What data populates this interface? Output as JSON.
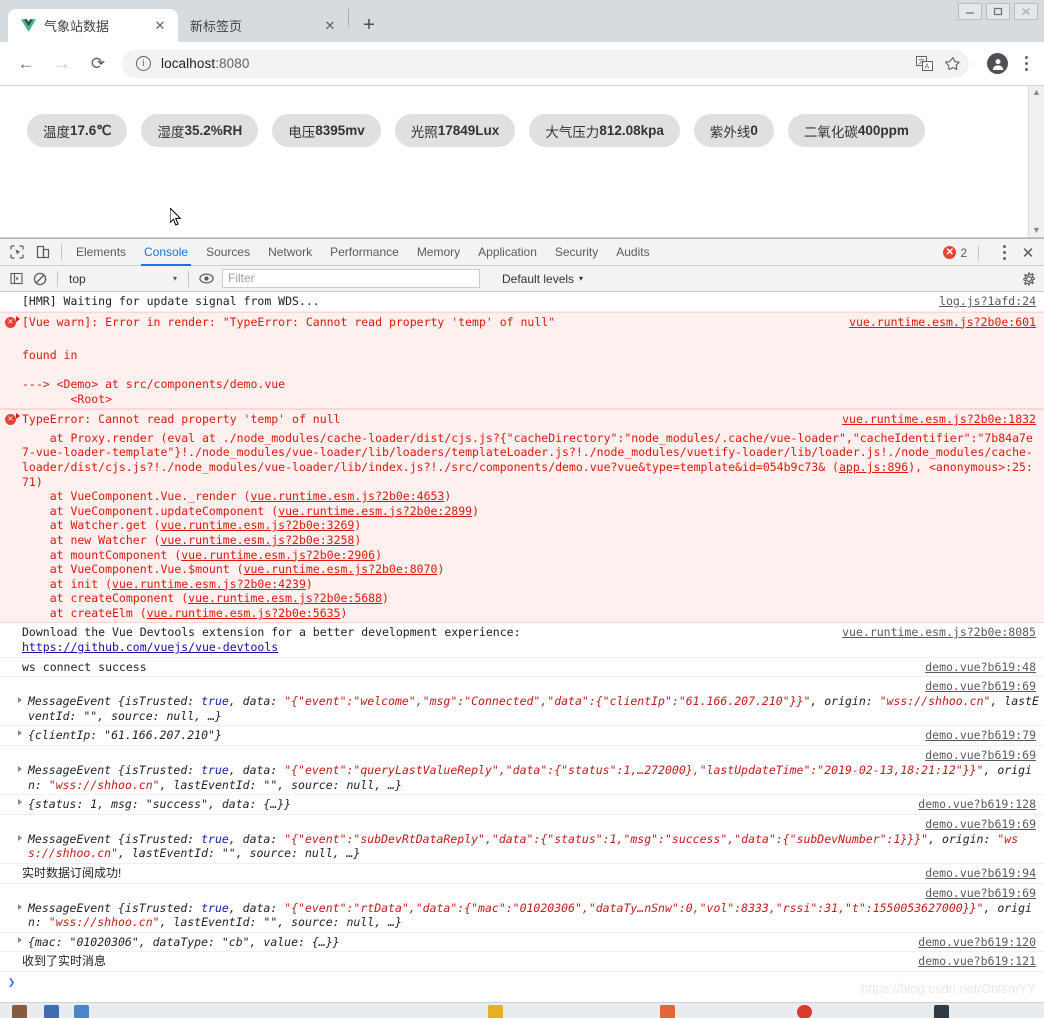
{
  "window": {
    "controls": {
      "minimize": "—",
      "maximize": "❐",
      "close": "✕"
    }
  },
  "tabs": [
    {
      "title": "气象站数据",
      "favicon": "vue-logo-icon",
      "close": "✕",
      "active": true
    },
    {
      "title": "新标签页",
      "favicon": "",
      "close": "✕",
      "active": false
    }
  ],
  "new_tab_label": "+",
  "toolbar": {
    "back": "←",
    "forward": "→",
    "reload": "⟳",
    "info_icon": "ⓘ",
    "url_host": "localhost",
    "url_port": ":8080",
    "translate_icon": "translate-icon",
    "bookmark_icon": "★",
    "profile_icon": "profile-icon",
    "menu_icon": "⋮"
  },
  "page": {
    "chips": [
      {
        "label": "温度",
        "value": "17.6℃"
      },
      {
        "label": "湿度",
        "value": "35.2%RH"
      },
      {
        "label": "电压",
        "value": "8395mv"
      },
      {
        "label": "光照",
        "value": "17849Lux"
      },
      {
        "label": "大气压力",
        "value": "812.08kpa"
      },
      {
        "label": "紫外线",
        "value": "0"
      },
      {
        "label": "二氧化碳",
        "value": "400ppm"
      }
    ],
    "scroll_up": "▲",
    "scroll_down": "▼"
  },
  "devtools": {
    "inspect_icon": "inspect-element-icon",
    "device_icon": "toggle-device-toolbar-icon",
    "tabs": [
      {
        "label": "Elements",
        "active": false
      },
      {
        "label": "Console",
        "active": true
      },
      {
        "label": "Sources",
        "active": false
      },
      {
        "label": "Network",
        "active": false
      },
      {
        "label": "Performance",
        "active": false
      },
      {
        "label": "Memory",
        "active": false
      },
      {
        "label": "Application",
        "active": false
      },
      {
        "label": "Security",
        "active": false
      },
      {
        "label": "Audits",
        "active": false
      }
    ],
    "error_badge": {
      "symbol": "✕",
      "count": "2"
    },
    "more_icon": "⋮",
    "close_icon": "✕",
    "console_toolbar": {
      "sidebar_icon": "show-console-sidebar-icon",
      "clear_icon": "clear-console-icon",
      "context": "top",
      "context_caret": "▾",
      "eye_icon": "live-expression-icon",
      "filter_placeholder": "Filter",
      "filter_value": "",
      "levels": "Default levels",
      "levels_caret": "▾",
      "settings_icon": "gear-icon"
    },
    "prompt_caret": "❯"
  },
  "console_rows": [
    {
      "kind": "plain",
      "text": "[HMR] Waiting for update signal from WDS...",
      "link": "log.js?1afd:24"
    },
    {
      "kind": "error-collapsed",
      "text": "[Vue warn]: Error in render: \"TypeError: Cannot read property 'temp' of null\"",
      "link": "vue.runtime.esm.js?2b0e:601"
    },
    {
      "kind": "error-body",
      "text": "\nfound in\n\n---> <Demo> at src/components/demo.vue\n       <Root>",
      "link": ""
    },
    {
      "kind": "error-collapsed",
      "text": "TypeError: Cannot read property 'temp' of null",
      "link": "vue.runtime.esm.js?2b0e:1832",
      "stack_head": "    at Proxy.render (eval at ./node_modules/cache-loader/dist/cjs.js?{\"cacheDirectory\":\"node_modules/.cache/vue-loader\",\"cacheIdentifier\":\"7b84a7e7-vue-loader-template\"}!./node_modules/vue-loader/lib/loaders/templateLoader.js?!./node_modules/vuetify-loader/lib/loader.js!./node_modules/cache-loader/dist/cjs.js?!./node_modules/vue-loader/lib/index.js?!./src/components/demo.vue?vue&type=template&id=054b9c73& (",
      "stack_head_link": "app.js:896",
      "stack_head_tail": "), <anonymous>:25:71)",
      "frames": [
        {
          "fn": "    at VueComponent.Vue._render (",
          "link": "vue.runtime.esm.js?2b0e:4653",
          "tail": ")"
        },
        {
          "fn": "    at VueComponent.updateComponent (",
          "link": "vue.runtime.esm.js?2b0e:2899",
          "tail": ")"
        },
        {
          "fn": "    at Watcher.get (",
          "link": "vue.runtime.esm.js?2b0e:3269",
          "tail": ")"
        },
        {
          "fn": "    at new Watcher (",
          "link": "vue.runtime.esm.js?2b0e:3258",
          "tail": ")"
        },
        {
          "fn": "    at mountComponent (",
          "link": "vue.runtime.esm.js?2b0e:2906",
          "tail": ")"
        },
        {
          "fn": "    at VueComponent.Vue.$mount (",
          "link": "vue.runtime.esm.js?2b0e:8070",
          "tail": ")"
        },
        {
          "fn": "    at init (",
          "link": "vue.runtime.esm.js?2b0e:4239",
          "tail": ")"
        },
        {
          "fn": "    at createComponent (",
          "link": "vue.runtime.esm.js?2b0e:5688",
          "tail": ")"
        },
        {
          "fn": "    at createElm (",
          "link": "vue.runtime.esm.js?2b0e:5635",
          "tail": ")"
        }
      ]
    },
    {
      "kind": "devtools-tip",
      "text": "Download the Vue Devtools extension for a better development experience:",
      "url": "https://github.com/vuejs/vue-devtools",
      "link": "vue.runtime.esm.js?2b0e:8085"
    },
    {
      "kind": "plain",
      "text": "ws connect success",
      "link": "demo.vue?b619:48"
    },
    {
      "kind": "message-event",
      "link": "demo.vue?b619:69",
      "data": "\"{\"event\":\"welcome\",\"msg\":\"Connected\",\"data\":{\"clientIp\":\"61.166.207.210\"}}\"",
      "origin": "\"wss://shhoo.cn\""
    },
    {
      "kind": "object",
      "link": "demo.vue?b619:79",
      "body": "{clientIp: \"61.166.207.210\"}"
    },
    {
      "kind": "message-event",
      "link": "demo.vue?b619:69",
      "data": "\"{\"event\":\"queryLastValueReply\",\"data\":{\"status\":1,…272000},\"lastUpdateTime\":\"2019-02-13,18:21:12\"}}\"",
      "origin": "\"wss://shhoo.cn\""
    },
    {
      "kind": "object",
      "link": "demo.vue?b619:128",
      "body": "{status: 1, msg: \"success\", data: {…}}"
    },
    {
      "kind": "message-event",
      "link": "demo.vue?b619:69",
      "data": "\"{\"event\":\"subDevRtDataReply\",\"data\":{\"status\":1,\"msg\":\"success\",\"data\":{\"subDevNumber\":1}}}\"",
      "origin": "\"wss://shhoo.cn\""
    },
    {
      "kind": "plain-cn",
      "text": "实时数据订阅成功!",
      "link": "demo.vue?b619:94"
    },
    {
      "kind": "message-event",
      "link": "demo.vue?b619:69",
      "data": "\"{\"event\":\"rtData\",\"data\":{\"mac\":\"01020306\",\"dataTy…nSnw\":0,\"vol\":8333,\"rssi\":31,\"t\":1550053627000}}\"",
      "origin": "\"wss://shhoo.cn\""
    },
    {
      "kind": "object",
      "link": "demo.vue?b619:120",
      "body": "{mac: \"01020306\", dataType: \"cb\", value: {…}}"
    },
    {
      "kind": "plain-cn",
      "text": "收到了实时消息",
      "link": "demo.vue?b619:121"
    }
  ],
  "message_event_suffix": {
    "prefix": "MessageEvent {isTrusted: ",
    "trusted": "true",
    "data_key": ", data: ",
    "origin_key": ", origin: ",
    "rest": ", lastEventId: \"\", source: null, …}"
  },
  "watermark": "https://blog.csdn.net/OnismYY",
  "colors": {
    "accent": "#1a73e8",
    "error": "#e1170b",
    "error_bg": "#fff0f0",
    "chip_bg": "#e0e0e0",
    "chrome_bg": "#d6dbe0"
  }
}
